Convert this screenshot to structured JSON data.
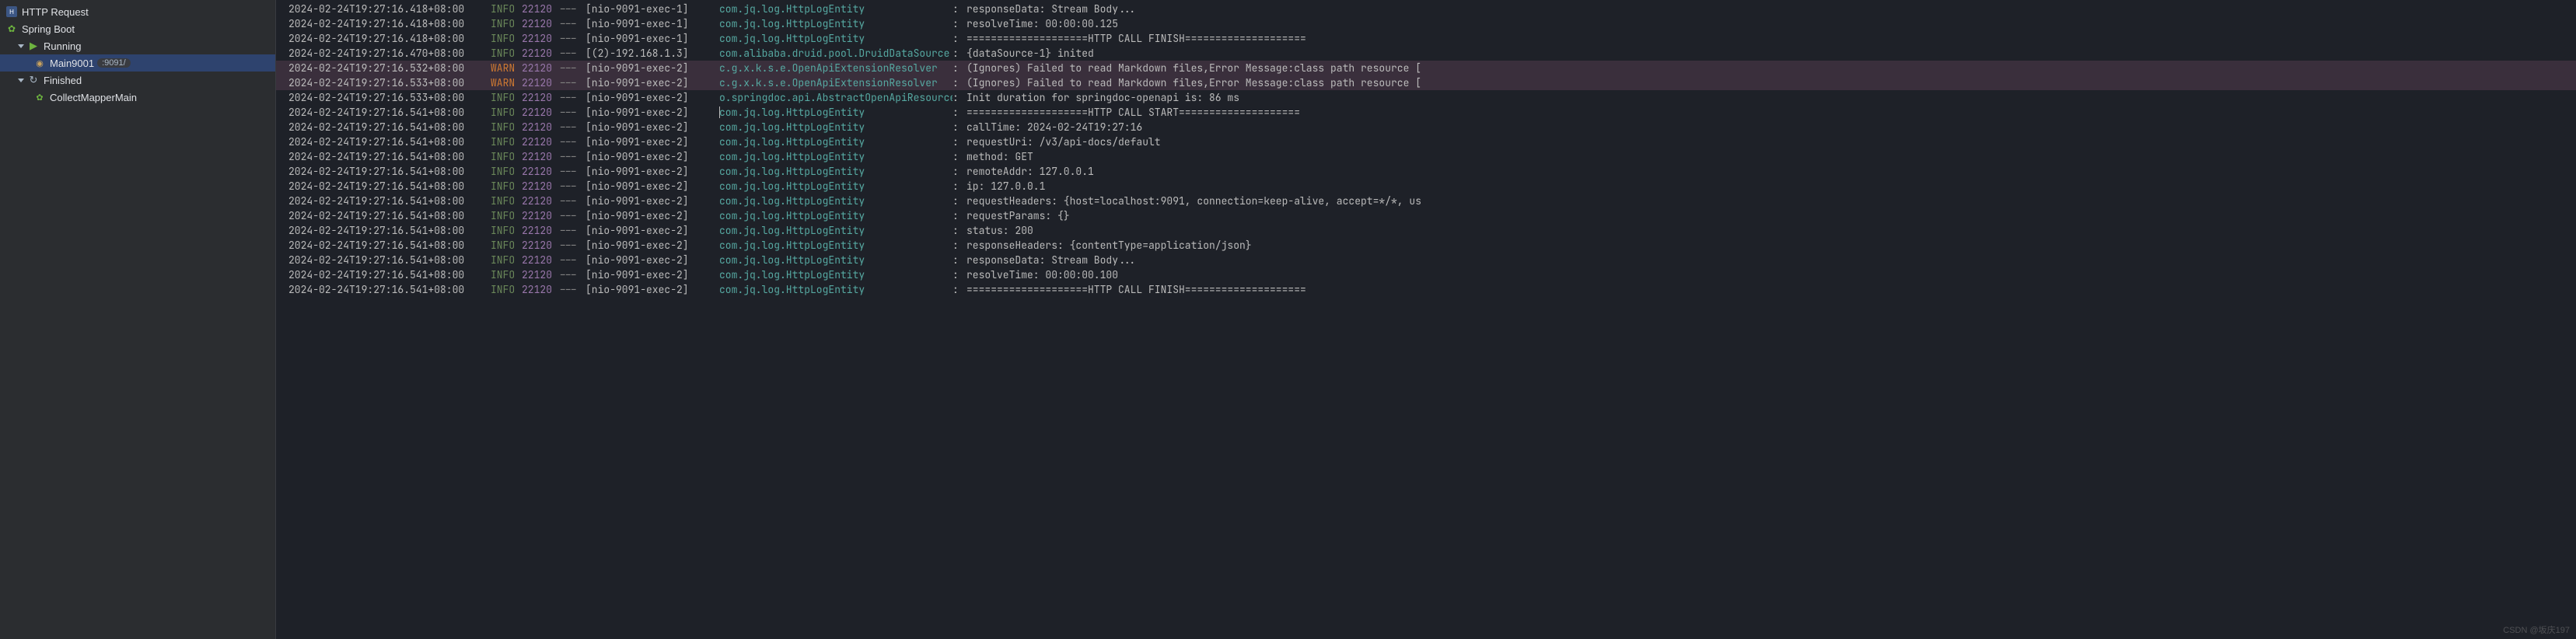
{
  "sidebar": {
    "httpRequest": "HTTP Request",
    "springBoot": "Spring Boot",
    "running": "Running",
    "main9001": "Main9001",
    "port": ":9091/",
    "finished": "Finished",
    "collectMapper": "CollectMapperMain"
  },
  "pid": "22120",
  "sep": "---",
  "logs": [
    {
      "ts": "2024-02-24T19:27:16.418+08:00",
      "lvl": "INFO",
      "thread": "[nio-9091-exec-1]",
      "logger": "com.jq.log.HttpLogEntity",
      "msg": "responseData: Stream Body..."
    },
    {
      "ts": "2024-02-24T19:27:16.418+08:00",
      "lvl": "INFO",
      "thread": "[nio-9091-exec-1]",
      "logger": "com.jq.log.HttpLogEntity",
      "msg": "resolveTime: 00:00:00.125"
    },
    {
      "ts": "2024-02-24T19:27:16.418+08:00",
      "lvl": "INFO",
      "thread": "[nio-9091-exec-1]",
      "logger": "com.jq.log.HttpLogEntity",
      "msg": "====================HTTP CALL FINISH===================="
    },
    {
      "ts": "2024-02-24T19:27:16.470+08:00",
      "lvl": "INFO",
      "thread": "[(2)-192.168.1.3]",
      "logger": "com.alibaba.druid.pool.DruidDataSource",
      "msg": "{dataSource-1} inited"
    },
    {
      "ts": "2024-02-24T19:27:16.532+08:00",
      "lvl": "WARN",
      "thread": "[nio-9091-exec-2]",
      "logger": "c.g.x.k.s.e.OpenApiExtensionResolver",
      "msg": "(Ignores) Failed to read Markdown files,Error Message:class path resource ["
    },
    {
      "ts": "2024-02-24T19:27:16.533+08:00",
      "lvl": "WARN",
      "thread": "[nio-9091-exec-2]",
      "logger": "c.g.x.k.s.e.OpenApiExtensionResolver",
      "msg": "(Ignores) Failed to read Markdown files,Error Message:class path resource ["
    },
    {
      "ts": "2024-02-24T19:27:16.533+08:00",
      "lvl": "INFO",
      "thread": "[nio-9091-exec-2]",
      "logger": "o.springdoc.api.AbstractOpenApiResource",
      "msg": "Init duration for springdoc-openapi is: 86 ms"
    },
    {
      "ts": "2024-02-24T19:27:16.541+08:00",
      "lvl": "INFO",
      "thread": "[nio-9091-exec-2]",
      "logger": "com.jq.log.HttpLogEntity",
      "msg": "====================HTTP CALL START====================",
      "caret": true
    },
    {
      "ts": "2024-02-24T19:27:16.541+08:00",
      "lvl": "INFO",
      "thread": "[nio-9091-exec-2]",
      "logger": "com.jq.log.HttpLogEntity",
      "msg": "callTime: 2024-02-24T19:27:16"
    },
    {
      "ts": "2024-02-24T19:27:16.541+08:00",
      "lvl": "INFO",
      "thread": "[nio-9091-exec-2]",
      "logger": "com.jq.log.HttpLogEntity",
      "msg": "requestUri: /v3/api-docs/default"
    },
    {
      "ts": "2024-02-24T19:27:16.541+08:00",
      "lvl": "INFO",
      "thread": "[nio-9091-exec-2]",
      "logger": "com.jq.log.HttpLogEntity",
      "msg": "method: GET"
    },
    {
      "ts": "2024-02-24T19:27:16.541+08:00",
      "lvl": "INFO",
      "thread": "[nio-9091-exec-2]",
      "logger": "com.jq.log.HttpLogEntity",
      "msg": "remoteAddr: 127.0.0.1"
    },
    {
      "ts": "2024-02-24T19:27:16.541+08:00",
      "lvl": "INFO",
      "thread": "[nio-9091-exec-2]",
      "logger": "com.jq.log.HttpLogEntity",
      "msg": "ip: 127.0.0.1"
    },
    {
      "ts": "2024-02-24T19:27:16.541+08:00",
      "lvl": "INFO",
      "thread": "[nio-9091-exec-2]",
      "logger": "com.jq.log.HttpLogEntity",
      "msg": "requestHeaders: {host=localhost:9091, connection=keep-alive, accept=*/*, us"
    },
    {
      "ts": "2024-02-24T19:27:16.541+08:00",
      "lvl": "INFO",
      "thread": "[nio-9091-exec-2]",
      "logger": "com.jq.log.HttpLogEntity",
      "msg": "requestParams: {}"
    },
    {
      "ts": "2024-02-24T19:27:16.541+08:00",
      "lvl": "INFO",
      "thread": "[nio-9091-exec-2]",
      "logger": "com.jq.log.HttpLogEntity",
      "msg": "status: 200"
    },
    {
      "ts": "2024-02-24T19:27:16.541+08:00",
      "lvl": "INFO",
      "thread": "[nio-9091-exec-2]",
      "logger": "com.jq.log.HttpLogEntity",
      "msg": "responseHeaders: {contentType=application/json}"
    },
    {
      "ts": "2024-02-24T19:27:16.541+08:00",
      "lvl": "INFO",
      "thread": "[nio-9091-exec-2]",
      "logger": "com.jq.log.HttpLogEntity",
      "msg": "responseData: Stream Body..."
    },
    {
      "ts": "2024-02-24T19:27:16.541+08:00",
      "lvl": "INFO",
      "thread": "[nio-9091-exec-2]",
      "logger": "com.jq.log.HttpLogEntity",
      "msg": "resolveTime: 00:00:00.100"
    },
    {
      "ts": "2024-02-24T19:27:16.541+08:00",
      "lvl": "INFO",
      "thread": "[nio-9091-exec-2]",
      "logger": "com.jq.log.HttpLogEntity",
      "msg": "====================HTTP CALL FINISH===================="
    }
  ],
  "watermark": "CSDN @坂庆197"
}
